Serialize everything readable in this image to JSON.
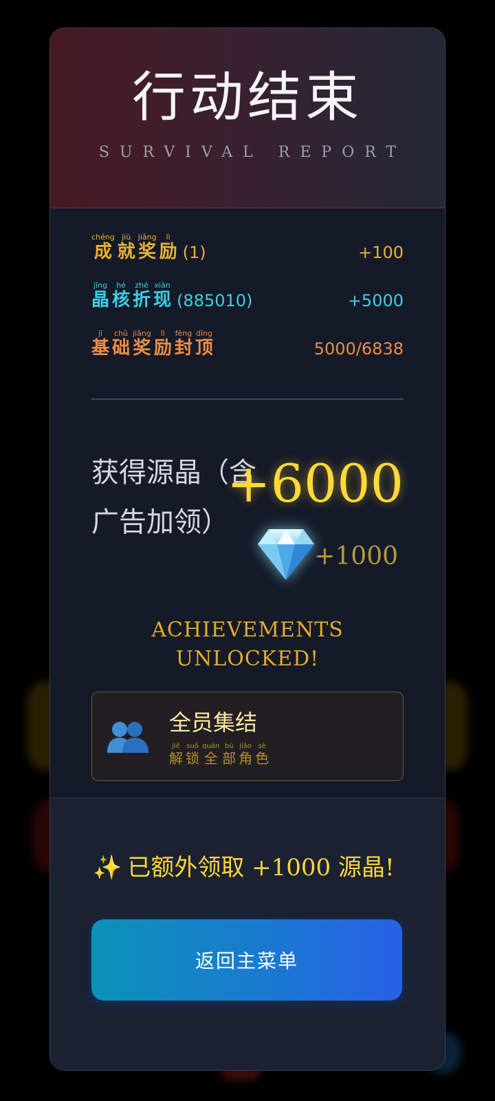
{
  "header": {
    "title": "行动结束",
    "subtitle": "SURVIVAL REPORT"
  },
  "rows": [
    {
      "chars": [
        {
          "py": "chéng",
          "hz": "成"
        },
        {
          "py": "jiù",
          "hz": "就"
        },
        {
          "py": "jiǎng",
          "hz": "奖"
        },
        {
          "py": "lì",
          "hz": "励"
        }
      ],
      "suffix": "(1)",
      "value": "+100",
      "color": "#e7b232"
    },
    {
      "chars": [
        {
          "py": "jīng",
          "hz": "晶"
        },
        {
          "py": "hé",
          "hz": "核"
        },
        {
          "py": "zhé",
          "hz": "折"
        },
        {
          "py": "xiàn",
          "hz": "现"
        }
      ],
      "suffix": "(885010)",
      "value": "+5000",
      "color": "#3ccfe4"
    },
    {
      "chars": [
        {
          "py": "jī",
          "hz": "基"
        },
        {
          "py": "chǔ",
          "hz": "础"
        },
        {
          "py": "jiǎng",
          "hz": "奖"
        },
        {
          "py": "lì",
          "hz": "励"
        },
        {
          "py": "fēng",
          "hz": "封"
        },
        {
          "py": "dǐng",
          "hz": "顶"
        }
      ],
      "suffix": "",
      "value": "5000/6838",
      "color": "#ef8c46"
    }
  ],
  "reward": {
    "label": "获得源晶（含广告加领）",
    "amount": "+6000",
    "icon": "diamond-icon",
    "bonus": "+1000"
  },
  "achievements": {
    "title": "ACHIEVEMENTS UNLOCKED!",
    "items": [
      {
        "icon": "group-people-icon",
        "name": "全员集结",
        "desc_chars": [
          {
            "py": "jiě",
            "hz": "解"
          },
          {
            "py": "suǒ",
            "hz": "锁"
          },
          {
            "py": "quán",
            "hz": "全"
          },
          {
            "py": "bù",
            "hz": "部"
          },
          {
            "py": "jiǎo",
            "hz": "角"
          },
          {
            "py": "sè",
            "hz": "色"
          }
        ]
      }
    ]
  },
  "footer": {
    "extra_icon": "sparkles-icon",
    "extra_message": "已额外领取 +1000 源晶!",
    "back_button": "返回主菜单"
  }
}
